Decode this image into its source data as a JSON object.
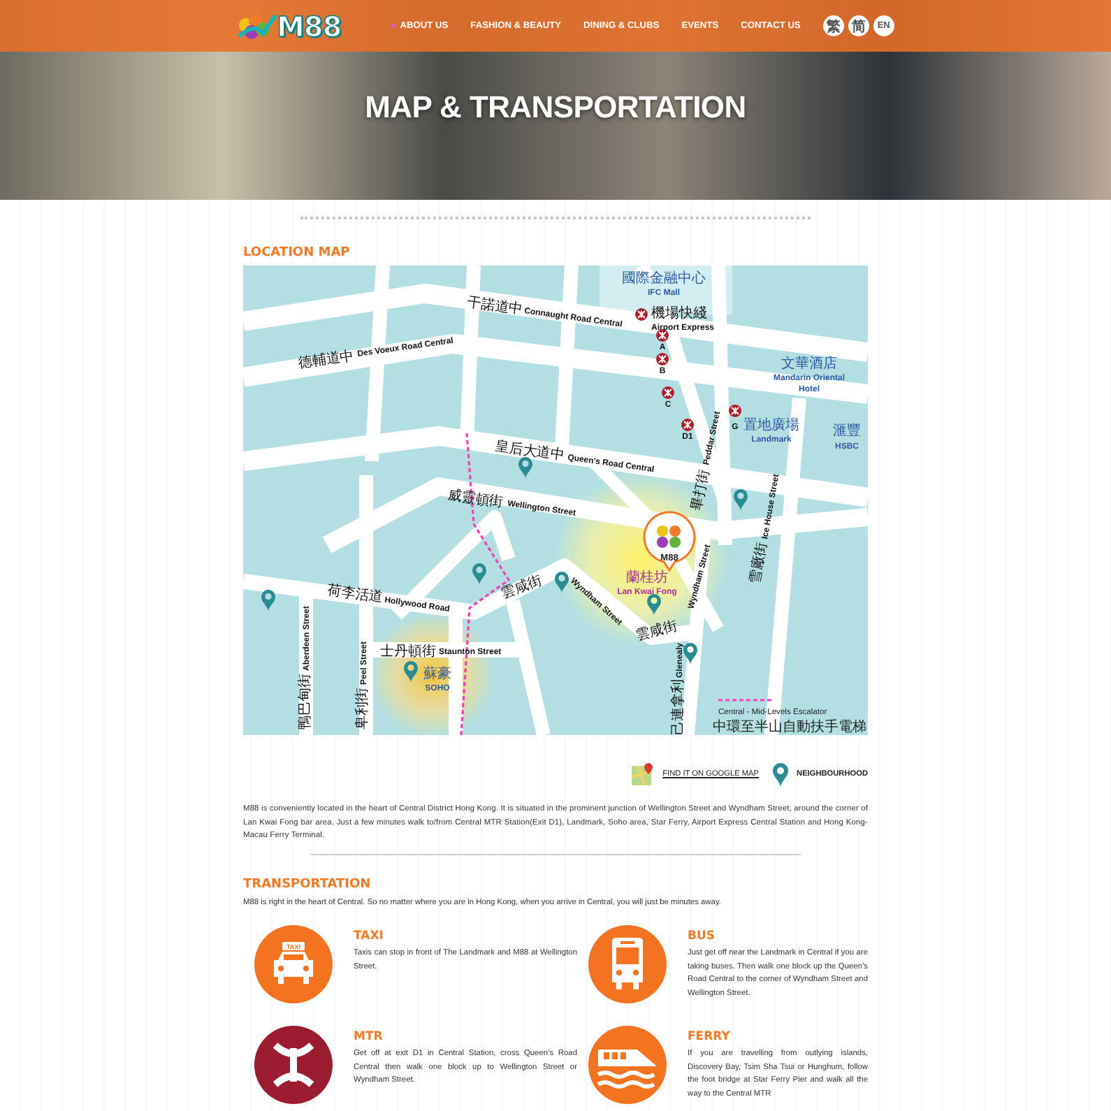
{
  "nav": {
    "logo": "M88",
    "items": [
      {
        "label": "ABOUT US",
        "selected": true
      },
      {
        "label": "FASHION & BEAUTY",
        "selected": false
      },
      {
        "label": "DINING & CLUBS",
        "selected": false
      },
      {
        "label": "EVENTS",
        "selected": false
      },
      {
        "label": "CONTACT US",
        "selected": false
      }
    ],
    "languages": [
      "繁",
      "简",
      "EN"
    ]
  },
  "hero": {
    "title": "MAP & TRANSPORTATION"
  },
  "location": {
    "heading": "LOCATION MAP",
    "map": {
      "marker": "M88",
      "labels": [
        {
          "kind": "zh",
          "text": "國際金融中心"
        },
        {
          "kind": "en",
          "text": "IFC Mall"
        },
        {
          "kind": "zh",
          "text": "機場快綫"
        },
        {
          "kind": "en",
          "text": "Airport Express"
        },
        {
          "kind": "zh",
          "text": "干諾道中"
        },
        {
          "kind": "en",
          "text": "Connaught Road Central"
        },
        {
          "kind": "zh",
          "text": "德輔道中"
        },
        {
          "kind": "en",
          "text": "Des Voeux Road Central"
        },
        {
          "kind": "en",
          "text": "A"
        },
        {
          "kind": "en",
          "text": "B"
        },
        {
          "kind": "en",
          "text": "C"
        },
        {
          "kind": "en",
          "text": "D1"
        },
        {
          "kind": "en",
          "text": "G"
        },
        {
          "kind": "zh",
          "text": "文華酒店"
        },
        {
          "kind": "en",
          "text": "Mandarin Oriental"
        },
        {
          "kind": "en",
          "text": "Hotel"
        },
        {
          "kind": "zh",
          "text": "置地廣場"
        },
        {
          "kind": "en",
          "text": "Landmark"
        },
        {
          "kind": "zh",
          "text": "滙豐"
        },
        {
          "kind": "en",
          "text": "HSBC"
        },
        {
          "kind": "zh",
          "text": "畢打街"
        },
        {
          "kind": "en",
          "text": "Peddar Street"
        },
        {
          "kind": "zh",
          "text": "雪廠街"
        },
        {
          "kind": "en",
          "text": "Ice House Street"
        },
        {
          "kind": "zh",
          "text": "皇后大道中"
        },
        {
          "kind": "en",
          "text": "Queen's Road Central"
        },
        {
          "kind": "zh",
          "text": "威靈頓街"
        },
        {
          "kind": "en",
          "text": "Wellington Street"
        },
        {
          "kind": "zh",
          "text": "荷李活道"
        },
        {
          "kind": "en",
          "text": "Hollywood Road"
        },
        {
          "kind": "zh",
          "text": "士丹頓街"
        },
        {
          "kind": "en",
          "text": "Staunton Street"
        },
        {
          "kind": "zh",
          "text": "鴨巴甸街"
        },
        {
          "kind": "en",
          "text": "Aberdeen Street"
        },
        {
          "kind": "zh",
          "text": "卑利街"
        },
        {
          "kind": "en",
          "text": "Peel Street"
        },
        {
          "kind": "zh",
          "text": "雲咸街"
        },
        {
          "kind": "en",
          "text": "Wyndham Street"
        },
        {
          "kind": "zh",
          "text": "雲咸街"
        },
        {
          "kind": "en",
          "text": "Wyndham Street"
        },
        {
          "kind": "zh",
          "text": "己連拿利"
        },
        {
          "kind": "en",
          "text": "Glenealy"
        },
        {
          "kind": "zh",
          "text": "蘭桂坊"
        },
        {
          "kind": "en",
          "text": "Lan Kwai Fong"
        },
        {
          "kind": "zh",
          "text": "蘇豪"
        },
        {
          "kind": "en",
          "text": "SOHO"
        }
      ],
      "legend": [
        "Central - Mid-Levels Escalator",
        "中環至半山自動扶手電梯"
      ]
    },
    "links": [
      {
        "kind": "google",
        "label": "FIND IT ON GOOGLE MAP"
      },
      {
        "kind": "pin",
        "label": "NEIGHBOURHOOD"
      }
    ],
    "description": "M88 is conveniently located in the heart of Central District Hong Kong. It is situated in the prominent junction of Wellington Street and Wyndham Street, around the corner of Lan Kwai Fong bar area. Just a few minutes walk to/from Central MTR Station(Exit D1), Landmark, Soho area, Star Ferry, Airport Express Central Station and Hong Kong-Macau Ferry Terminal."
  },
  "transportation": {
    "heading": "TRANSPORTATION",
    "intro": "M88 is right in the heart of Central. So no matter where you are in Hong Kong, when you arrive in Central, you will just be minutes away.",
    "modes": [
      {
        "kind": "taxi",
        "color": "#f37321",
        "badge": "TAXI",
        "title": "TAXI",
        "text": "Taxis can stop in front of The Landmark and M88 at Wellington Street."
      },
      {
        "kind": "bus",
        "color": "#f37321",
        "title": "BUS",
        "text": "Just get off near the Landmark in Central if you are taking buses. Then walk one block up the Queen’s Road Central to the corner of Wyndham Street and Wellington Street."
      },
      {
        "kind": "mtr",
        "color": "#9b1c31",
        "title": "MTR",
        "text": "Get off at exit D1 in Central Station, cross Queen’s Road Central then walk one block up to Wellington Street or Wyndham Street."
      },
      {
        "kind": "ferry",
        "color": "#f37321",
        "title": "FERRY",
        "text": "If you are travelling from outlying islands, Discovery Bay, Tsim Sha Tsui or Hunghum, follow the foot bridge at Star Ferry Pier and walk all the way to the Central MTR"
      }
    ]
  }
}
